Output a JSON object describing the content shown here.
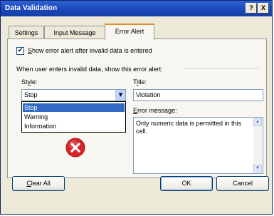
{
  "window": {
    "title": "Data Validation",
    "help_glyph": "?",
    "close_glyph": "X"
  },
  "tabs": [
    {
      "label": "Settings",
      "active": false
    },
    {
      "label": "Input Message",
      "active": false
    },
    {
      "label": "Error Alert",
      "active": true
    }
  ],
  "error_alert": {
    "show_alert_checked": true,
    "show_alert_label_prefix": "S",
    "show_alert_label_rest": "how error alert after invalid data is entered",
    "section_heading": "When user enters invalid data, show this error alert:",
    "style_label_prefix": "St",
    "style_label_u": "y",
    "style_label_rest": "le:",
    "style_selected": "Stop",
    "style_options": [
      "Stop",
      "Warning",
      "Information"
    ],
    "title_label_prefix": "T",
    "title_label_u": "i",
    "title_label_rest": "tle:",
    "title_value": "Violation",
    "message_label_u": "E",
    "message_label_rest": "rror message:",
    "message_value": "Only numeric data is permitted in this cell.",
    "icon": "stop-error-icon"
  },
  "buttons": {
    "clear_all_u": "C",
    "clear_all_rest": "lear All",
    "ok": "OK",
    "cancel": "Cancel"
  },
  "colors": {
    "titlebar": "#1b47b8",
    "selection": "#316ac5",
    "active_tab_accent": "#e68b2c",
    "stop_icon": "#d8232a"
  }
}
